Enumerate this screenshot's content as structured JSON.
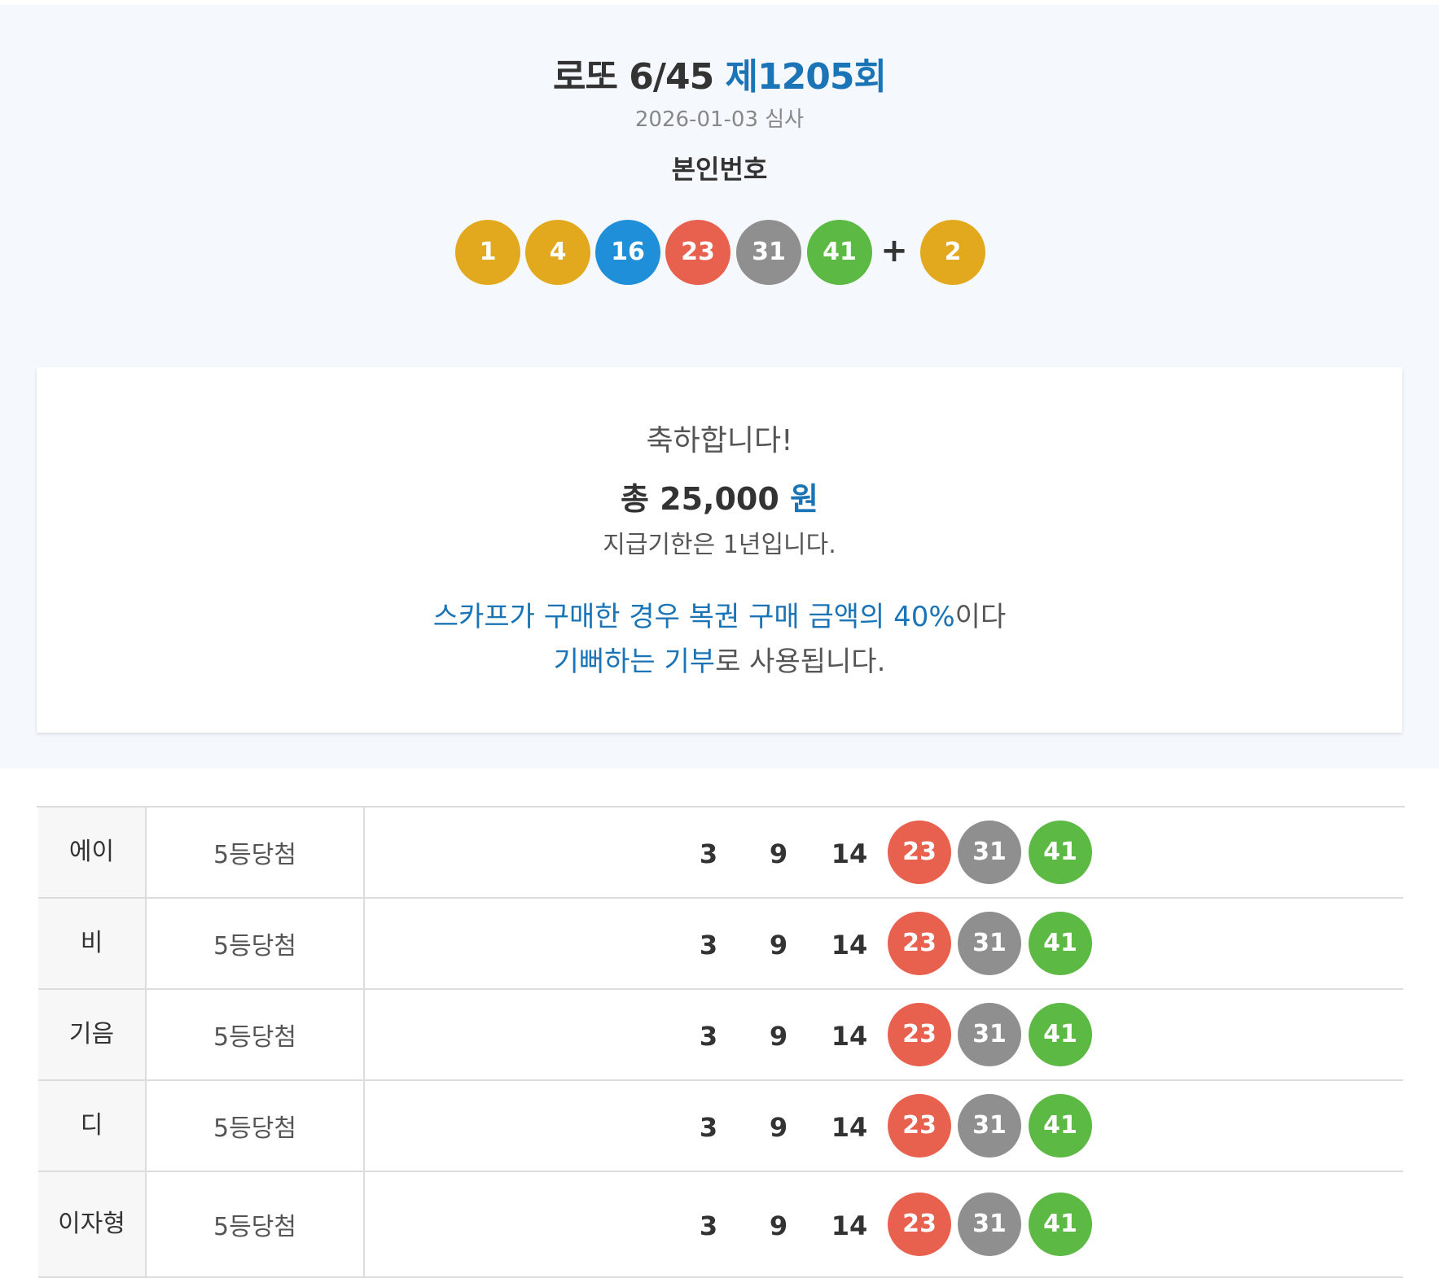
{
  "header": {
    "game_title": "로또 6/45",
    "round_label": "제1205회",
    "draw_date": "2026-01-03 심사",
    "my_numbers_label": "본인번호"
  },
  "my_numbers": {
    "balls": [
      "1",
      "4",
      "16",
      "23",
      "31",
      "41"
    ],
    "plus": "+",
    "bonus": "2"
  },
  "ball_colors": {
    "yellow": "#e3a91e",
    "blue": "#1e8fd8",
    "red": "#e8614f",
    "gray": "#8f8f8f",
    "green": "#5cb944"
  },
  "summary": {
    "congrats": "축하합니다!",
    "total_prefix": "총 25,000",
    "total_unit": "원",
    "deadline": "지급기한은 1년입니다.",
    "donation_line1_blue": "스카프가 구매한 경우 복권 구매 금액의 40%",
    "donation_line1_rest": "이다",
    "donation_line2_blue": "기뻐하는 기부",
    "donation_line2_rest": "로 사용됩니다."
  },
  "results": [
    {
      "name": "에이",
      "rank": "5등당첨",
      "plain": [
        "3",
        "9",
        "14"
      ],
      "matched": [
        "23",
        "31",
        "41"
      ]
    },
    {
      "name": "비",
      "rank": "5등당첨",
      "plain": [
        "3",
        "9",
        "14"
      ],
      "matched": [
        "23",
        "31",
        "41"
      ]
    },
    {
      "name": "기음",
      "rank": "5등당첨",
      "plain": [
        "3",
        "9",
        "14"
      ],
      "matched": [
        "23",
        "31",
        "41"
      ]
    },
    {
      "name": "디",
      "rank": "5등당첨",
      "plain": [
        "3",
        "9",
        "14"
      ],
      "matched": [
        "23",
        "31",
        "41"
      ]
    },
    {
      "name": "이자형",
      "rank": "5등당첨",
      "plain": [
        "3",
        "9",
        "14"
      ],
      "matched": [
        "23",
        "31",
        "41"
      ]
    }
  ]
}
